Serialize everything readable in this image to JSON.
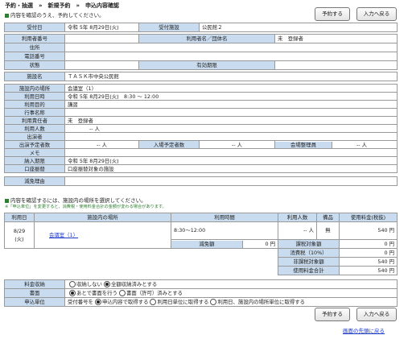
{
  "breadcrumb": {
    "text": "予約・抽選　»　新規予約　»　申込内容確認"
  },
  "notice": "内容を確認のうえ、予約してください。",
  "buttons": {
    "reserve": "予約する",
    "back": "入力へ戻る"
  },
  "applicant": {
    "accept_date_label": "受付日",
    "accept_date": "令和 5年 8月29日(火)",
    "facility_label": "受付施設",
    "facility": "公民館２",
    "user_no_label": "利用者番号",
    "user_no": "",
    "user_name_label": "利用者名／団体名",
    "user_name": "未　登録者",
    "address_label": "住所",
    "address": "",
    "phone_label": "電話番号",
    "phone": "",
    "status_label": "状態",
    "status": "",
    "expiry_label": "有効期限",
    "expiry": ""
  },
  "reservation": {
    "facility_name_label": "施設名",
    "facility_name": "ＴＡＳＫ市中央公民館",
    "place_label": "施設内の場所",
    "place": "会議室（1）",
    "datetime_label": "利用日時",
    "datetime": "令和 5年 8月29日(火)　8:30 ～ 12:00",
    "purpose_label": "利用目的",
    "purpose": "講習",
    "event_label": "行事名称",
    "event": "",
    "responsible_label": "利用責任者",
    "responsible": "未　登録者",
    "people_label": "利用人数",
    "people": "-- 人",
    "performer_label": "出演者",
    "performer": "",
    "performers_count_label": "出演予定者数",
    "performers_count": "-- 人",
    "visitors_label": "入場予定者数",
    "visitors": "-- 人",
    "staff_label": "会場整理員",
    "staff": "-- 人",
    "memo_label": "メモ",
    "memo": "",
    "pay_deadline_label": "納入期限",
    "pay_deadline": "令和 5年 8月29日(火)",
    "transfer_label": "口座振替",
    "transfer": "口座振替対象の施設"
  },
  "cancel_reason": {
    "label": "減免理由",
    "value": ""
  },
  "notes": {
    "line1": "内容を確認するには、施設内の場所を選択してください。",
    "line2": "※「申込単位」を変更すると、消費税・使用料金合計の金額が変わる場合があります。"
  },
  "fees": {
    "headers": [
      "利用日",
      "施設内の場所",
      "利用時間",
      "利用人数",
      "備品",
      "使用料金(税抜)"
    ],
    "row": {
      "date": "8/29",
      "weekday": "(火)",
      "place": "会議室（1）",
      "time": "8:30～12:00",
      "people": "-- 人",
      "equip": "無",
      "fee": "540 円"
    },
    "reduction_label": "減免額",
    "reduction": "0 円",
    "summary": [
      {
        "label": "課税対象額",
        "value": "0 円"
      },
      {
        "label": "消費税（10%）",
        "value": "0 円"
      },
      {
        "label": "非課税対象額",
        "value": "540 円"
      },
      {
        "label": "使用料金合計",
        "value": "540 円"
      }
    ]
  },
  "options": {
    "fee_collect_label": "料金収納",
    "fee_collect_opts": [
      "収納しない",
      "全額収納済みとする"
    ],
    "document_label": "書面",
    "document_opts": [
      "あとで書面を行う",
      "書面（許可）済みとする"
    ],
    "unit_label": "申込単位",
    "unit_prefix": "受付番号を",
    "unit_opts": [
      "申込内容で取得する",
      "利用日単位に取得する",
      "利用日、施設内の場所単位に取得する"
    ]
  },
  "footer_link": "画面の先頭に戻る"
}
